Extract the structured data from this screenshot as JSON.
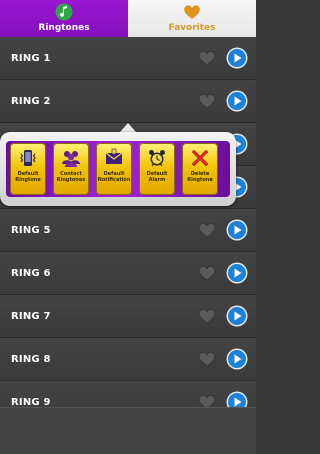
{
  "tabs": [
    {
      "label": "Ringtones",
      "icon": "music-note-icon",
      "active": true
    },
    {
      "label": "Favorites",
      "icon": "heart-icon",
      "active": false
    }
  ],
  "rings": [
    {
      "label": "RING 1"
    },
    {
      "label": "RING 2"
    },
    {
      "label": ""
    },
    {
      "label": ""
    },
    {
      "label": "RING 5"
    },
    {
      "label": "RING 6"
    },
    {
      "label": "RING 7"
    },
    {
      "label": "RING 8"
    },
    {
      "label": "RING 9"
    }
  ],
  "popup": {
    "actions": [
      {
        "label": "Default\nRingtone",
        "icon": "phone-vibrate-icon"
      },
      {
        "label": "Contact\nRingtones",
        "icon": "contacts-icon"
      },
      {
        "label": "Default\nNotification",
        "icon": "envelope-icon"
      },
      {
        "label": "Default\nAlarm",
        "icon": "alarm-clock-icon"
      },
      {
        "label": "Delete\nRingtone",
        "icon": "delete-x-icon"
      }
    ]
  },
  "colors": {
    "tab_active": "#8e13c4",
    "tab_inactive_text": "#d89a2a",
    "list_bg": "#3e3e3e",
    "play_blue": "#1a82d8",
    "popup_purple": "#a124d8",
    "popup_button": "#f2c40a"
  }
}
